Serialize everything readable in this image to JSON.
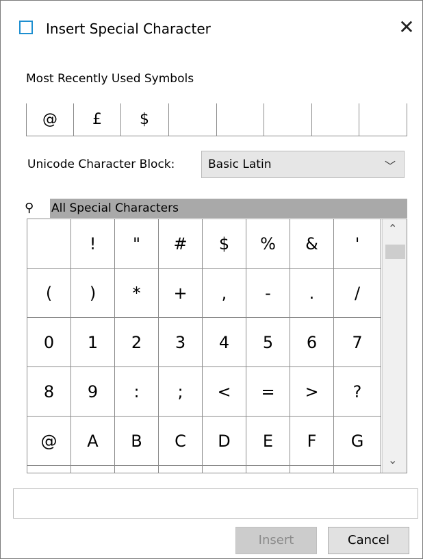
{
  "window": {
    "title": "Insert Special Character",
    "close_glyph": "✕"
  },
  "mru": {
    "label": "Most Recently Used Symbols",
    "symbols": [
      "@",
      "£",
      "$",
      "",
      "",
      "",
      "",
      ""
    ]
  },
  "block": {
    "label": "Unicode Character Block:",
    "value": "Basic Latin",
    "chevron": "﹀"
  },
  "filter": {
    "icon_glyph": "⚲",
    "label": "All Special Characters"
  },
  "grid": {
    "rows": [
      [
        " ",
        "!",
        "\"",
        "#",
        "$",
        "%",
        "&",
        "'"
      ],
      [
        "(",
        ")",
        "*",
        "+",
        ",",
        "-",
        ".",
        "/"
      ],
      [
        "0",
        "1",
        "2",
        "3",
        "4",
        "5",
        "6",
        "7"
      ],
      [
        "8",
        "9",
        ":",
        ";",
        "<",
        "=",
        ">",
        "?"
      ],
      [
        "@",
        "A",
        "B",
        "C",
        "D",
        "E",
        "F",
        "G"
      ],
      [
        "",
        "",
        "",
        "",
        "",
        "",
        "",
        ""
      ]
    ],
    "scroll_up_glyph": "⌃",
    "scroll_down_glyph": "⌄"
  },
  "preview": {
    "value": ""
  },
  "buttons": {
    "insert": "Insert",
    "cancel": "Cancel"
  }
}
